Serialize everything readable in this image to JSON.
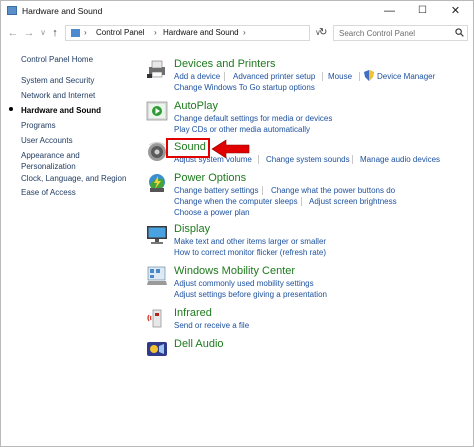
{
  "window": {
    "title": "Hardware and Sound",
    "minimize": "—",
    "maximize": "☐",
    "close": "✕"
  },
  "nav": {
    "back": "←",
    "forward": "→",
    "recent": "∨",
    "up": "↑",
    "breadcrumb": [
      "Control Panel",
      "Hardware and Sound"
    ],
    "sep": "›",
    "dropdown": "∨",
    "refresh": "↻",
    "search_placeholder": "Search Control Panel"
  },
  "sidebar": {
    "items": [
      {
        "label": "Control Panel Home"
      },
      {
        "label": "System and Security"
      },
      {
        "label": "Network and Internet"
      },
      {
        "label": "Hardware and Sound"
      },
      {
        "label": "Programs"
      },
      {
        "label": "User Accounts"
      },
      {
        "label": "Appearance and"
      },
      {
        "label": "Personalization"
      },
      {
        "label": "Clock, Language, and Region"
      },
      {
        "label": "Ease of Access"
      }
    ]
  },
  "categories": {
    "devices": {
      "title": "Devices and Printers",
      "links": [
        "Add a device",
        "Advanced printer setup",
        "Mouse",
        "Device Manager",
        "Change Windows To Go startup options"
      ]
    },
    "autoplay": {
      "title": "AutoPlay",
      "links": [
        "Change default settings for media or devices",
        "Play CDs or other media automatically"
      ]
    },
    "sound": {
      "title": "Sound",
      "links": [
        "Adjust system volume",
        "Change system sounds",
        "Manage audio devices"
      ]
    },
    "power": {
      "title": "Power Options",
      "links": [
        "Change battery settings",
        "Change what the power buttons do",
        "Change when the computer sleeps",
        "Adjust screen brightness",
        "Choose a power plan"
      ]
    },
    "display": {
      "title": "Display",
      "links": [
        "Make text and other items larger or smaller",
        "How to correct monitor flicker (refresh rate)"
      ]
    },
    "mobility": {
      "title": "Windows Mobility Center",
      "links": [
        "Adjust commonly used mobility settings",
        "Adjust settings before giving a presentation"
      ]
    },
    "infrared": {
      "title": "Infrared",
      "links": [
        "Send or receive a file"
      ]
    },
    "dell": {
      "title": "Dell Audio",
      "links": []
    }
  },
  "colors": {
    "category_title": "#1e7a1e",
    "link": "#1e52a0",
    "highlight": "#e10000"
  }
}
